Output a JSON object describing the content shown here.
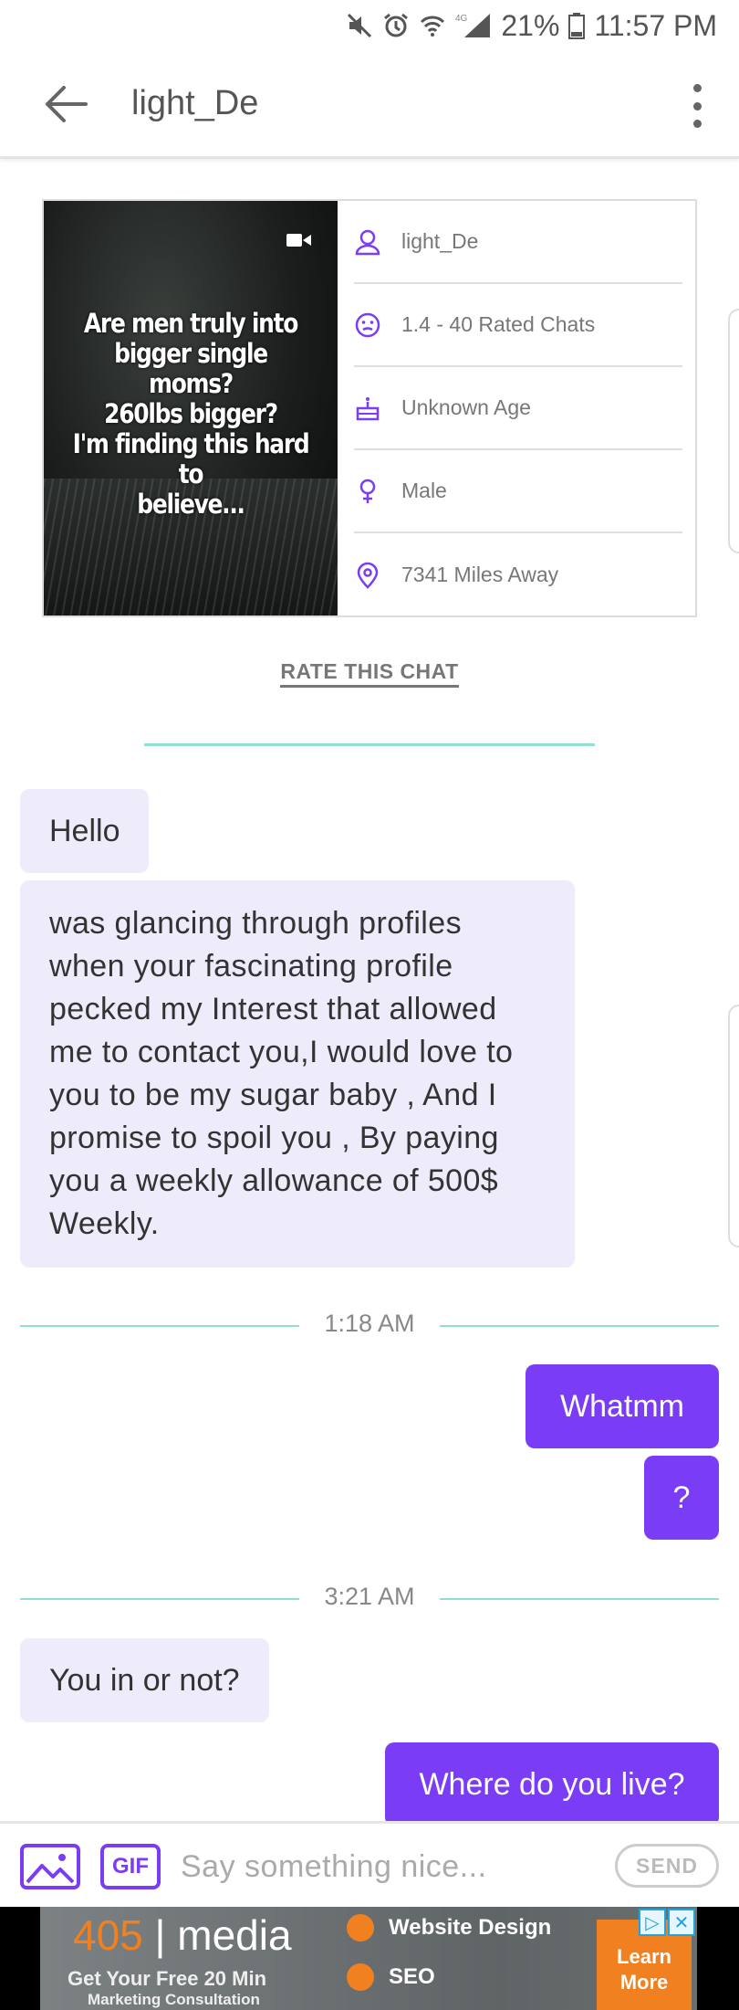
{
  "status_bar": {
    "battery": "21%",
    "time": "11:57 PM",
    "network": "4G"
  },
  "app_bar": {
    "title": "light_De"
  },
  "profile": {
    "photo_caption": "Are men truly into\nbigger single moms?\n260lbs bigger?\nI'm finding this hard to\nbelieve...",
    "username": "light_De",
    "rating": "1.4 - 40 Rated Chats",
    "age": "Unknown Age",
    "gender": "Male",
    "distance": "7341 Miles Away"
  },
  "rate_link": "RATE THIS CHAT",
  "messages": {
    "m1": "Hello",
    "m2": "was glancing through profiles when your fascinating profile pecked my Interest that allowed me to contact you,I would love to you to be my sugar baby , And I promise to spoil you , By paying you a weekly allowance of 500$ Weekly.",
    "ts1": "1:18 AM",
    "m3": "Whatmm",
    "m4": "?",
    "ts2": "3:21 AM",
    "m5": "You in or not?",
    "m6": "Where do you live?"
  },
  "composer": {
    "gif_label": "GIF",
    "placeholder": "Say something nice...",
    "send_label": "SEND"
  },
  "ad": {
    "brand_number": "405",
    "brand_name": "| media",
    "line1": "Get Your Free 20 Min",
    "line2": "Marketing Consultation",
    "item1": "Website Design",
    "item2": "SEO",
    "cta": "Learn More"
  },
  "colors": {
    "accent": "#7a3cf5",
    "incoming_bubble": "#eeebfb",
    "divider_teal": "#8fe0d3",
    "ad_orange": "#f08020"
  }
}
